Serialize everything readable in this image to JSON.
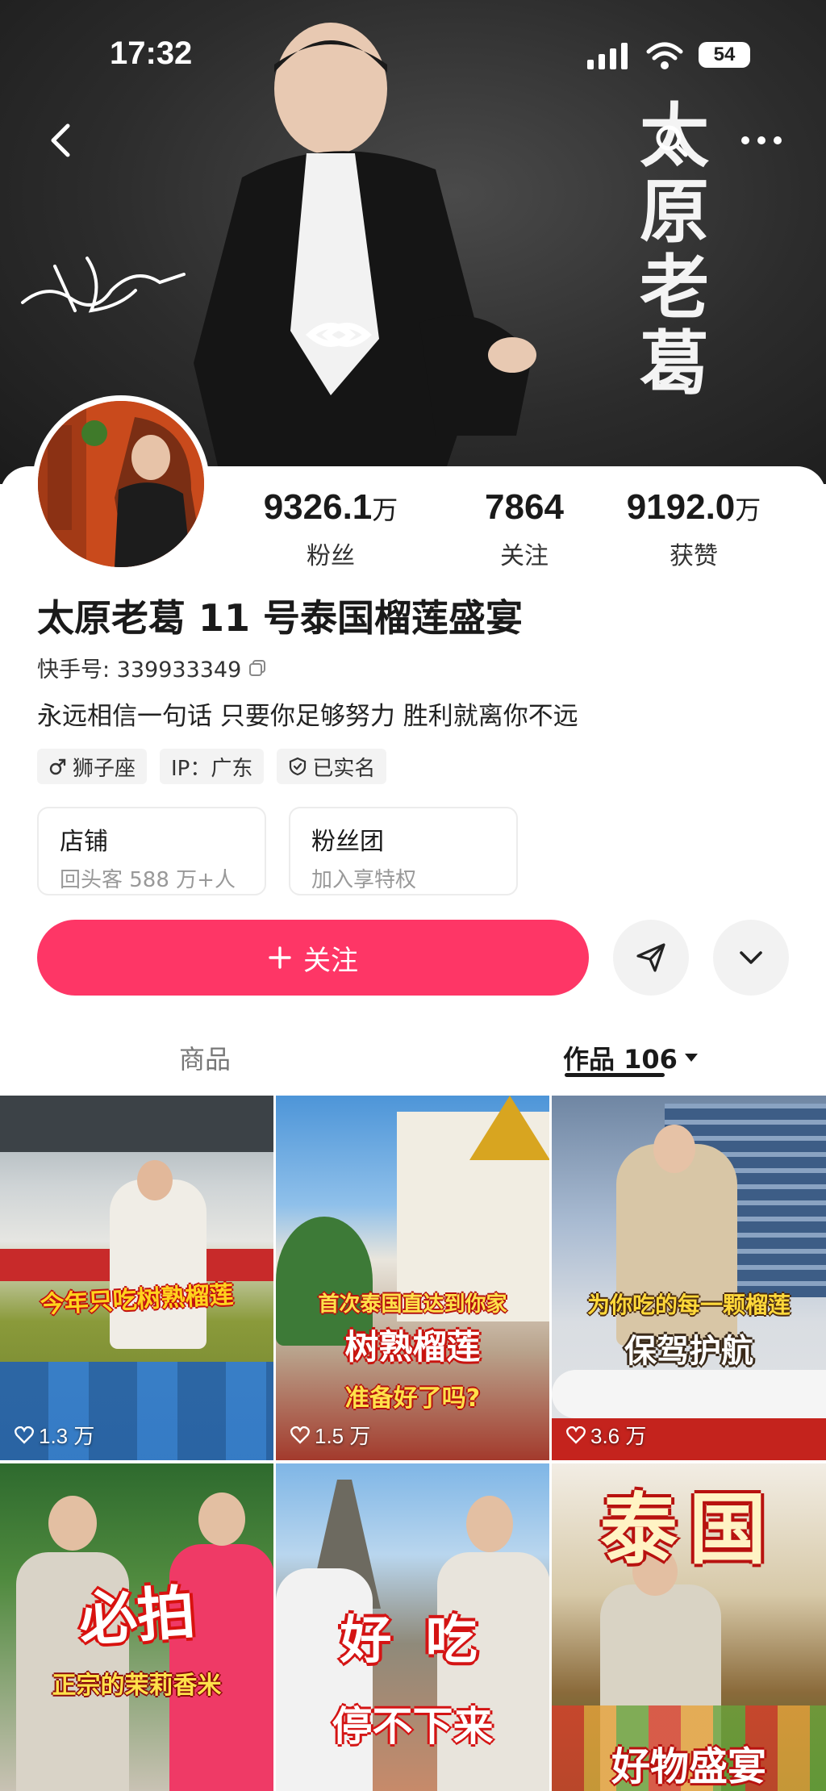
{
  "status_bar": {
    "time": "17:32",
    "battery": "54"
  },
  "banner": {
    "title_chars": [
      "太",
      "原",
      "老",
      "葛"
    ]
  },
  "profile": {
    "name": "太原老葛 11 号泰国榴莲盛宴",
    "uid": "快手号: 339933349",
    "bio": "永远相信一句话 只要你足够努力 胜利就离你不远",
    "stats": [
      {
        "value": "9326.1",
        "unit": "万",
        "label": "粉丝"
      },
      {
        "value": "7864",
        "unit": "",
        "label": "关注"
      },
      {
        "value": "9192.0",
        "unit": "万",
        "label": "获赞"
      }
    ],
    "tags": [
      {
        "icon": "male-icon",
        "label": "狮子座"
      },
      {
        "icon": "",
        "label": "IP：广东"
      },
      {
        "icon": "shield-icon",
        "label": "已实名"
      }
    ],
    "cards": [
      {
        "title": "店铺",
        "sub": "回头客 588 万+人"
      },
      {
        "title": "粉丝团",
        "sub": "加入享特权"
      }
    ],
    "follow_label": "关注"
  },
  "tabs": {
    "goods": "商品",
    "works": "作品 106"
  },
  "videos": [
    {
      "caption": "今年只吃树熟榴莲",
      "likes": "1.3 万"
    },
    {
      "caption_top": "首次泰国直达到你家",
      "caption_mid": "树熟榴莲",
      "caption_bottom": "准备好了吗?",
      "likes": "1.5 万"
    },
    {
      "caption_top": "为你吃的每一颗榴莲",
      "caption_mid": "保驾护航",
      "likes": "3.6 万"
    },
    {
      "caption_top": "必拍",
      "caption_bottom": "正宗的茉莉香米"
    },
    {
      "caption_top": "好 吃",
      "caption_bottom": "停不下来"
    },
    {
      "caption_top": "泰国",
      "caption_bottom": "好物盛宴"
    }
  ],
  "colors": {
    "accent": "#fe3666"
  }
}
